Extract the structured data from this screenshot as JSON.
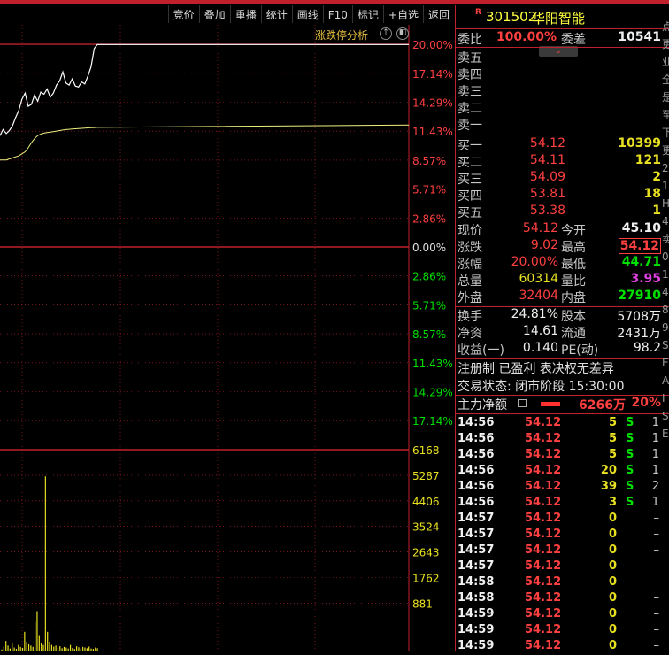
{
  "toolbar": [
    "竞价",
    "叠加",
    "重播",
    "统计",
    "画线",
    "F10",
    "标记",
    "+自选",
    "返回"
  ],
  "chart": {
    "title": "涨跌停分析",
    "btn_up": "↑",
    "btn_close": "◧",
    "pct_labels_top": [
      "20.00%",
      "17.14%",
      "14.29%",
      "11.43%",
      "8.57%",
      "5.71%",
      "2.86%",
      "0.00%"
    ],
    "pct_labels_bottom": [
      "2.86%",
      "5.71%",
      "8.57%",
      "11.43%",
      "14.29%",
      "17.14%"
    ],
    "vol_labels": [
      "6168",
      "5287",
      "4406",
      "3524",
      "2643",
      "1762",
      "881"
    ],
    "price_series": [
      11.0,
      11.6,
      11.2,
      11.5,
      12.0,
      12.8,
      13.5,
      14.6,
      15.2,
      13.9,
      14.1,
      15.0,
      14.4,
      15.3,
      15.1,
      15.6,
      14.8,
      15.2,
      16.0,
      16.4,
      17.3,
      16.2,
      16.0,
      16.6,
      15.9,
      15.8,
      16.3,
      16.1,
      16.9,
      17.8,
      19.6,
      20.0
    ],
    "avg_series": [
      8.6,
      8.6,
      8.6,
      8.7,
      8.8,
      8.9,
      9.0,
      9.2,
      9.4,
      9.8,
      10.3,
      10.7,
      11.0,
      11.15,
      11.25,
      11.3,
      11.35,
      11.4,
      11.45,
      11.5,
      11.55,
      11.6,
      11.62,
      11.65,
      11.68,
      11.7,
      11.72,
      11.74,
      11.76,
      11.78,
      11.8,
      11.82
    ],
    "volumes": [
      60,
      150,
      320,
      180,
      90,
      250,
      120,
      80,
      200,
      140,
      110,
      600,
      300,
      220,
      180,
      140,
      900,
      1230,
      500,
      260,
      200,
      5350,
      600,
      300,
      200,
      150,
      180,
      120,
      160,
      100,
      140,
      120,
      90,
      200,
      110,
      80,
      160,
      130,
      90,
      140,
      120,
      100,
      150,
      90,
      80,
      120,
      100
    ]
  },
  "stock": {
    "badge": "R",
    "code": "301502",
    "name": "华阳智能"
  },
  "order": {
    "wb_label": "委比",
    "wb_value": "100.00%",
    "wc_label": "委差",
    "wc_value": "10541"
  },
  "asks": [
    {
      "label": "卖五"
    },
    {
      "label": "卖四"
    },
    {
      "label": "卖三"
    },
    {
      "label": "卖二"
    },
    {
      "label": "卖一"
    }
  ],
  "bids": [
    {
      "label": "买一",
      "price": "54.12",
      "vol": "10399"
    },
    {
      "label": "买二",
      "price": "54.11",
      "vol": "121"
    },
    {
      "label": "买三",
      "price": "54.09",
      "vol": "2"
    },
    {
      "label": "买四",
      "price": "53.81",
      "vol": "18"
    },
    {
      "label": "买五",
      "price": "53.38",
      "vol": "1"
    }
  ],
  "quote": [
    {
      "l1": "现价",
      "v1": "54.12",
      "c1": "red",
      "l2": "今开",
      "v2": "45.10",
      "c2": "white"
    },
    {
      "l1": "涨跌",
      "v1": "9.02",
      "c1": "red",
      "l2": "最高",
      "v2": "54.12",
      "c2": "red"
    },
    {
      "l1": "涨幅",
      "v1": "20.00%",
      "c1": "red",
      "l2": "最低",
      "v2": "44.71",
      "c2": "green"
    },
    {
      "l1": "总量",
      "v1": "60314",
      "c1": "yellow",
      "l2": "量比",
      "v2": "3.95",
      "c2": "magenta"
    },
    {
      "l1": "外盘",
      "v1": "32404",
      "c1": "red",
      "l2": "内盘",
      "v2": "27910",
      "c2": "green"
    }
  ],
  "fundamentals": [
    {
      "l1": "换手",
      "v1": "24.81%",
      "l2": "股本",
      "v2": "5708万"
    },
    {
      "l1": "净资",
      "v1": "14.61",
      "l2": "流通",
      "v2": "2431万"
    },
    {
      "l1": "收益(一)",
      "v1": "0.140",
      "l2": "PE(动)",
      "v2": "98.2"
    }
  ],
  "reg_text": "注册制 已盈利 表决权无差异",
  "trade_status": "交易状态: 闭市阶段 15:30:00",
  "main_flow": {
    "label": "主力净额",
    "value": "6266万",
    "pct": "20%"
  },
  "ticks": [
    {
      "t": "14:56",
      "p": "54.12",
      "v": "5",
      "s": "S",
      "n": "1"
    },
    {
      "t": "14:56",
      "p": "54.12",
      "v": "5",
      "s": "S",
      "n": "1"
    },
    {
      "t": "14:56",
      "p": "54.12",
      "v": "5",
      "s": "S",
      "n": "1"
    },
    {
      "t": "14:56",
      "p": "54.12",
      "v": "20",
      "s": "S",
      "n": "1"
    },
    {
      "t": "14:56",
      "p": "54.12",
      "v": "39",
      "s": "S",
      "n": "2"
    },
    {
      "t": "14:56",
      "p": "54.12",
      "v": "3",
      "s": "S",
      "n": "1"
    },
    {
      "t": "14:57",
      "p": "54.12",
      "v": "0",
      "s": "",
      "n": "–"
    },
    {
      "t": "14:57",
      "p": "54.12",
      "v": "0",
      "s": "",
      "n": "–"
    },
    {
      "t": "14:57",
      "p": "54.12",
      "v": "0",
      "s": "",
      "n": "–"
    },
    {
      "t": "14:57",
      "p": "54.12",
      "v": "0",
      "s": "",
      "n": "–"
    },
    {
      "t": "14:58",
      "p": "54.12",
      "v": "0",
      "s": "",
      "n": "–"
    },
    {
      "t": "14:58",
      "p": "54.12",
      "v": "0",
      "s": "",
      "n": "–"
    },
    {
      "t": "14:59",
      "p": "54.12",
      "v": "0",
      "s": "",
      "n": "–"
    },
    {
      "t": "14:59",
      "p": "54.12",
      "v": "0",
      "s": "",
      "n": "–"
    },
    {
      "t": "14:59",
      "p": "54.12",
      "v": "0",
      "s": "",
      "n": "–"
    }
  ],
  "edge_chars": [
    "点",
    "更",
    "业",
    "全",
    "是",
    "至",
    "下",
    "更",
    "2",
    "1",
    "H",
    "4",
    "卖",
    "0",
    "1",
    "4",
    "8",
    "9",
    "S",
    "E",
    "A",
    "I",
    "S",
    "E"
  ],
  "colors": {
    "accent": "#c0202c",
    "up": "#ff4040",
    "down": "#00e000",
    "vol": "#e8e020",
    "price_line": "#ffffff",
    "avg_line": "#f0f080"
  }
}
